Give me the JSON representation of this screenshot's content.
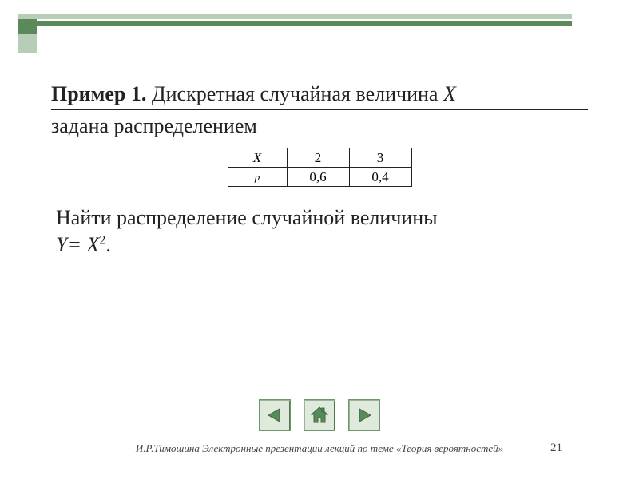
{
  "title": {
    "lead": "Пример 1.",
    "rest_a": " Дискретная случайная величина ",
    "var": "X",
    "rest_b": "задана распределением"
  },
  "table": {
    "header_var": "X",
    "header_p": "p",
    "cols": [
      {
        "x": "2",
        "p": "0,6"
      },
      {
        "x": "3",
        "p": "0,4"
      }
    ]
  },
  "body": {
    "line1": "Найти распределение случайной величины",
    "line2_lhs": "Y= X",
    "line2_sup": "2",
    "line2_tail": "."
  },
  "nav": {
    "prev": "prev-icon",
    "home": "home-icon",
    "next": "next-icon"
  },
  "footer": {
    "text": "И.Р.Тимошина Электронные презентации лекций по теме «Теория вероятностей»",
    "page": "21"
  },
  "colors": {
    "accent": "#5a8a5a",
    "accent_light": "#b8cdb8",
    "nav_bg": "#dfeadd"
  }
}
